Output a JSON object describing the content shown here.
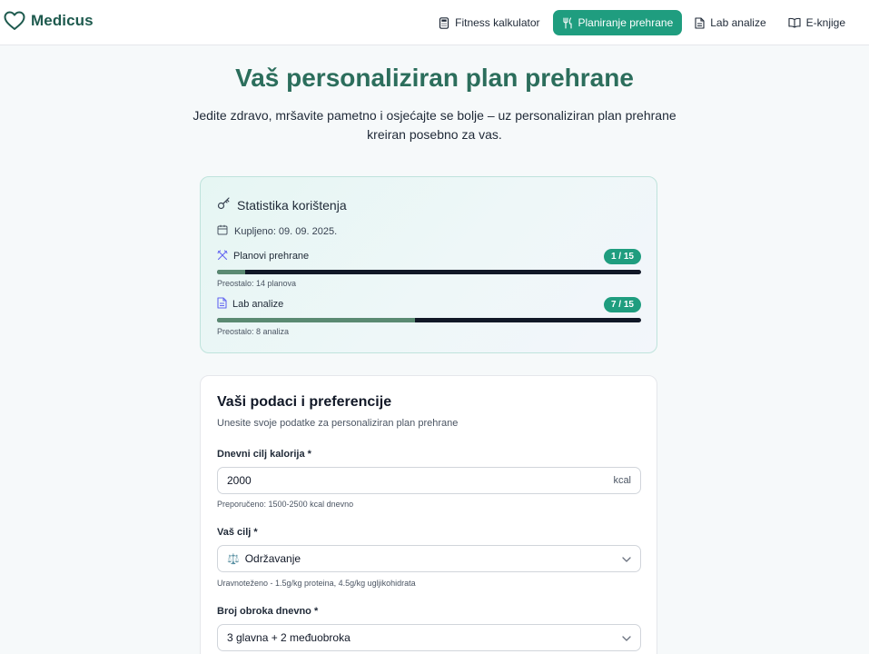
{
  "brand": {
    "name": "Medicus"
  },
  "nav": [
    {
      "label": "Fitness kalkulator",
      "icon": "calculator-icon",
      "active": false
    },
    {
      "label": "Planiranje prehrane",
      "icon": "utensils-icon",
      "active": true
    },
    {
      "label": "Lab analize",
      "icon": "file-text-icon",
      "active": false
    },
    {
      "label": "E-knjige",
      "icon": "book-open-icon",
      "active": false
    }
  ],
  "hero": {
    "title": "Vaš personaliziran plan prehrane",
    "subtitle": "Jedite zdravo, mršavite pametno i osjećajte se bolje – uz personaliziran plan prehrane kreiran posebno za vas."
  },
  "stats": {
    "title": "Statistika korištenja",
    "purchased": "Kupljeno: 09. 09. 2025.",
    "meters": [
      {
        "label": "Planovi prehrane",
        "badge": "1 / 15",
        "used": 1,
        "total": 15,
        "note": "Preostalo: 14 planova",
        "icon": "utensils-crossed-icon"
      },
      {
        "label": "Lab analize",
        "badge": "7 / 15",
        "used": 7,
        "total": 15,
        "note": "Preostalo: 8 analiza",
        "icon": "file-text-icon"
      }
    ]
  },
  "form": {
    "title": "Vaši podaci i preferencije",
    "subtitle": "Unesite svoje podatke za personaliziran plan prehrane",
    "calories": {
      "label": "Dnevni cilj kalorija *",
      "value": "2000",
      "unit": "kcal",
      "hint": "Preporučeno: 1500-2500 kcal dnevno"
    },
    "goal": {
      "label": "Vaš cilj *",
      "value": "Održavanje",
      "emoji": "⚖️",
      "hint": "Uravnoteženo - 1.5g/kg proteina, 4.5g/kg ugljikohidrata"
    },
    "meals": {
      "label": "Broj obroka dnevno *",
      "value": "3 glavna + 2 međuobroka"
    }
  },
  "colors": {
    "primary": "#1f9d7f",
    "brand_text": "#1e5a4e",
    "hero_title": "#2c6e5c",
    "bar_track": "#111827",
    "bar_fill": "#5a8a72"
  }
}
